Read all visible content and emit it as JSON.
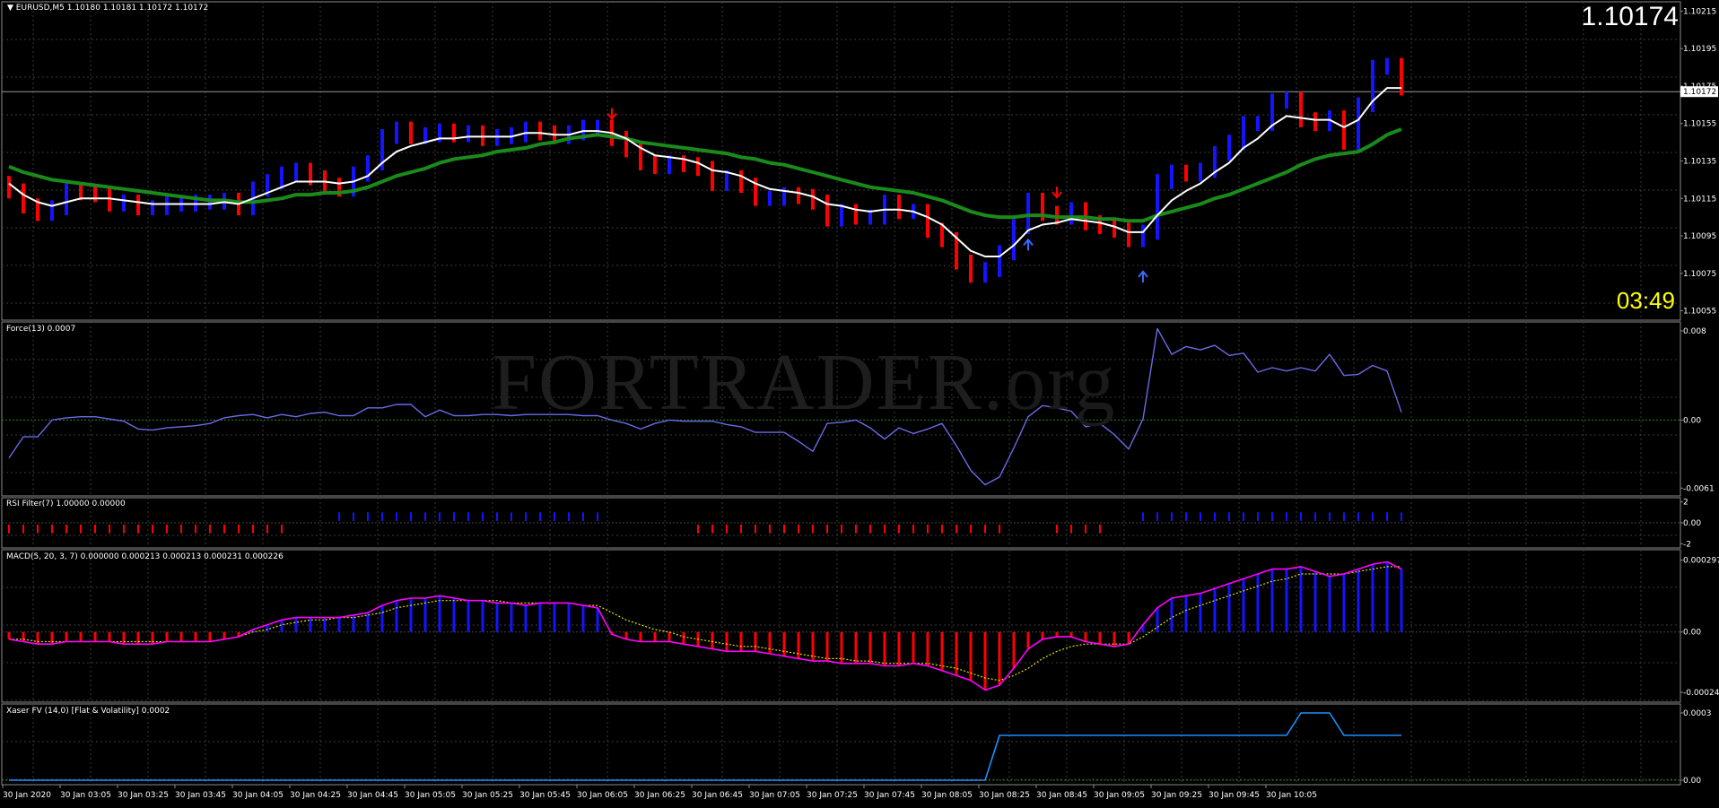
{
  "symbol_header": "EURUSD,M5  1.10180 1.10181 1.10172 1.10172",
  "big_price": "1.10174",
  "countdown": "03:49",
  "watermark": {
    "main": "FORTRADER",
    "suffix": ".org"
  },
  "colors": {
    "background": "#000000",
    "grid": "#3a3a3a",
    "bull_bar": "#1414ff",
    "bear_bar": "#ff0000",
    "fast_ma": "#ffffff",
    "slow_ma": "#1a8a1a",
    "force_line": "#6a6ae8",
    "macd_line": "#ff00ff",
    "signal_line": "#e0e000",
    "xaser_line": "#1e90ff"
  },
  "price_axis": {
    "ticks": [
      "1.10215",
      "1.10195",
      "1.10175",
      "1.10155",
      "1.10135",
      "1.10115",
      "1.10095",
      "1.10075",
      "1.10055"
    ],
    "current_label": "1.10172"
  },
  "force": {
    "title": "Force(13) 0.0007",
    "axis": [
      "0.008",
      "0.00",
      "-0.0061"
    ]
  },
  "rsi": {
    "title": "RSI Filter(7) 1.00000 0.00000",
    "axis": [
      "2",
      "0.00",
      "-2"
    ]
  },
  "macd": {
    "title": "MACD(5, 20, 3, 7) 0.000000 0.000213 0.000213 0.000231 0.000226",
    "axis": [
      "0.000297",
      "0.00",
      "-0.000249"
    ]
  },
  "xaser": {
    "title": "Xaser FV (14,0) [Flat & Volatility] 0.0002",
    "axis": [
      "0.0003",
      "0.00"
    ]
  },
  "time_axis": [
    "30 Jan 2020",
    "30 Jan 03:05",
    "30 Jan 03:25",
    "30 Jan 03:45",
    "30 Jan 04:05",
    "30 Jan 04:25",
    "30 Jan 04:45",
    "30 Jan 05:05",
    "30 Jan 05:25",
    "30 Jan 05:45",
    "30 Jan 06:05",
    "30 Jan 06:25",
    "30 Jan 06:45",
    "30 Jan 07:05",
    "30 Jan 07:25",
    "30 Jan 07:45",
    "30 Jan 08:05",
    "30 Jan 08:25",
    "30 Jan 08:45",
    "30 Jan 09:05",
    "30 Jan 09:25",
    "30 Jan 09:45",
    "30 Jan 10:05"
  ],
  "chart_data": {
    "type": "line",
    "title": "EURUSD,M5",
    "price_bars_close": [
      1.10119,
      1.10111,
      1.10107,
      1.1011,
      1.10119,
      1.10118,
      1.10117,
      1.10112,
      1.10113,
      1.1011,
      1.1011,
      1.10112,
      1.10112,
      1.10113,
      1.10113,
      1.10114,
      1.1011,
      1.1012,
      1.10124,
      1.10128,
      1.1013,
      1.10126,
      1.10122,
      1.1012,
      1.10128,
      1.10134,
      1.10148,
      1.10152,
      1.10148,
      1.10149,
      1.10151,
      1.10149,
      1.1015,
      1.10147,
      1.10148,
      1.10149,
      1.10152,
      1.1015,
      1.10148,
      1.1015,
      1.10153,
      1.10153,
      1.10147,
      1.10141,
      1.10134,
      1.10132,
      1.10134,
      1.10133,
      1.10131,
      1.10123,
      1.10126,
      1.10122,
      1.10115,
      1.10115,
      1.10117,
      1.10116,
      1.10113,
      1.10104,
      1.10108,
      1.10105,
      1.10105,
      1.10113,
      1.10108,
      1.10108,
      1.10098,
      1.10093,
      1.10081,
      1.10074,
      1.10077,
      1.10086,
      1.101,
      1.10114,
      1.10107,
      1.10105,
      1.10109,
      1.10102,
      1.101,
      1.10098,
      1.10093,
      1.10097,
      1.10124,
      1.10129,
      1.10128,
      1.1013,
      1.10139,
      1.10145,
      1.10155,
      1.10155,
      1.10167,
      1.10168,
      1.10157,
      1.10155,
      1.10158,
      1.10145,
      1.10165,
      1.10185,
      1.10186,
      1.10174
    ],
    "fast_ma": [
      1.10123,
      1.10117,
      1.10113,
      1.10111,
      1.10113,
      1.10115,
      1.10115,
      1.10115,
      1.10114,
      1.10113,
      1.10112,
      1.10112,
      1.10112,
      1.10112,
      1.10112,
      1.10113,
      1.10112,
      1.10115,
      1.10118,
      1.10121,
      1.10124,
      1.10124,
      1.10124,
      1.10123,
      1.10124,
      1.10127,
      1.10134,
      1.1014,
      1.10143,
      1.10145,
      1.10147,
      1.10147,
      1.10148,
      1.10148,
      1.10148,
      1.10148,
      1.1015,
      1.1015,
      1.10149,
      1.10149,
      1.10151,
      1.10151,
      1.1015,
      1.10147,
      1.10142,
      1.10138,
      1.10137,
      1.10136,
      1.10134,
      1.1013,
      1.10129,
      1.10127,
      1.10123,
      1.1012,
      1.10119,
      1.10118,
      1.10116,
      1.10112,
      1.10111,
      1.10109,
      1.10108,
      1.10109,
      1.10109,
      1.10108,
      1.10105,
      1.10101,
      1.10094,
      1.10087,
      1.10084,
      1.10084,
      1.1009,
      1.10098,
      1.10101,
      1.10102,
      1.10104,
      1.10103,
      1.10102,
      1.101,
      1.10097,
      1.10097,
      1.10106,
      1.10114,
      1.10119,
      1.10123,
      1.10129,
      1.10134,
      1.10142,
      1.10147,
      1.10154,
      1.10159,
      1.10158,
      1.10157,
      1.10157,
      1.10153,
      1.10157,
      1.10167,
      1.10174,
      1.10174
    ],
    "slow_ma": [
      1.10132,
      1.10129,
      1.10127,
      1.10125,
      1.10124,
      1.10123,
      1.10122,
      1.10121,
      1.1012,
      1.10119,
      1.10118,
      1.10117,
      1.10116,
      1.10115,
      1.10114,
      1.10114,
      1.10113,
      1.10113,
      1.10114,
      1.10115,
      1.10117,
      1.10117,
      1.10118,
      1.10118,
      1.10119,
      1.10121,
      1.10124,
      1.10127,
      1.10129,
      1.10131,
      1.10134,
      1.10136,
      1.10137,
      1.10138,
      1.1014,
      1.10141,
      1.10142,
      1.10144,
      1.10145,
      1.10147,
      1.10148,
      1.10149,
      1.10148,
      1.10147,
      1.10145,
      1.10144,
      1.10143,
      1.10142,
      1.10141,
      1.1014,
      1.10139,
      1.10137,
      1.10136,
      1.10134,
      1.10133,
      1.10131,
      1.10129,
      1.10127,
      1.10125,
      1.10123,
      1.10121,
      1.1012,
      1.10119,
      1.10118,
      1.10116,
      1.10114,
      1.10111,
      1.10108,
      1.10106,
      1.10105,
      1.10105,
      1.10106,
      1.10106,
      1.10105,
      1.10105,
      1.10105,
      1.10104,
      1.10104,
      1.10103,
      1.10103,
      1.10106,
      1.10108,
      1.1011,
      1.10112,
      1.10115,
      1.10117,
      1.1012,
      1.10123,
      1.10126,
      1.10129,
      1.10133,
      1.10136,
      1.10138,
      1.10139,
      1.1014,
      1.10144,
      1.10149,
      1.10152
    ],
    "force": [
      -0.0034,
      -0.0015,
      -0.0015,
      0.0,
      0.0002,
      0.0003,
      0.0003,
      0.0001,
      -0.0001,
      -0.0008,
      -0.0009,
      -0.0007,
      -0.0006,
      -0.0005,
      -0.0003,
      0.0002,
      0.0004,
      0.0005,
      0.0002,
      0.0005,
      0.0003,
      0.0006,
      0.0007,
      0.0004,
      0.0004,
      0.0011,
      0.0011,
      0.0014,
      0.0014,
      0.0003,
      0.0009,
      0.0004,
      0.0004,
      0.0005,
      0.0005,
      0.0004,
      0.0005,
      0.0005,
      0.0005,
      0.0005,
      0.0004,
      0.0004,
      0.0,
      -0.0003,
      -0.0008,
      -0.0003,
      0.0,
      -0.0001,
      -0.0001,
      -0.0001,
      -0.0004,
      -0.0006,
      -0.0011,
      -0.0011,
      -0.0011,
      -0.0019,
      -0.0028,
      -0.0003,
      -0.0002,
      0.0,
      -0.0007,
      -0.0017,
      -0.0007,
      -0.0012,
      -0.0008,
      -0.0003,
      -0.0023,
      -0.0045,
      -0.0058,
      -0.0051,
      -0.0025,
      0.0003,
      0.0013,
      0.0011,
      0.0008,
      -0.0006,
      -0.0003,
      -0.0013,
      -0.0026,
      0.0001,
      0.0082,
      0.0059,
      0.0066,
      0.0063,
      0.0067,
      0.0058,
      0.006,
      0.0043,
      0.0047,
      0.0044,
      0.0047,
      0.0044,
      0.0059,
      0.004,
      0.0041,
      0.0049,
      0.0044,
      0.0007
    ],
    "rsi_filter": [
      -1,
      -1,
      -1,
      -1,
      -1,
      -1,
      -1,
      -1,
      -1,
      -1,
      -1,
      -1,
      -1,
      -1,
      -1,
      -1,
      -1,
      -1,
      -1,
      -1,
      0,
      0,
      0,
      1,
      1,
      1,
      1,
      1,
      1,
      1,
      1,
      1,
      1,
      1,
      1,
      1,
      1,
      1,
      1,
      1,
      1,
      1,
      0,
      0,
      0,
      0,
      0,
      0,
      -1,
      -1,
      -1,
      -1,
      -1,
      -1,
      -1,
      -1,
      -1,
      -1,
      -1,
      -1,
      -1,
      -1,
      -1,
      -1,
      -1,
      -1,
      -1,
      -1,
      -1,
      -1,
      0,
      0,
      0,
      -1,
      -1,
      -1,
      -1,
      0,
      0,
      1,
      1,
      1,
      1,
      1,
      1,
      1,
      1,
      1,
      1,
      1,
      1,
      1,
      1,
      1,
      1,
      1,
      1,
      1
    ],
    "macd_hist": [
      -3e-05,
      -4e-05,
      -5e-05,
      -5e-05,
      -4e-05,
      -4e-05,
      -4e-05,
      -4e-05,
      -5e-05,
      -5e-05,
      -5e-05,
      -4e-05,
      -4e-05,
      -4e-05,
      -4e-05,
      -3e-05,
      -2e-05,
      1e-05,
      3e-05,
      5e-05,
      6e-05,
      6e-05,
      6e-05,
      6e-05,
      7e-05,
      8e-05,
      0.00011,
      0.00013,
      0.00014,
      0.00014,
      0.00015,
      0.00014,
      0.00013,
      0.00013,
      0.00012,
      0.00012,
      0.00011,
      0.00012,
      0.00012,
      0.00012,
      0.00011,
      0.0001,
      -1e-05,
      -3e-05,
      -4e-05,
      -4e-05,
      -4e-05,
      -5e-05,
      -6e-05,
      -7e-05,
      -8e-05,
      -8e-05,
      -8e-05,
      -9e-05,
      -0.0001,
      -0.00011,
      -0.00012,
      -0.00012,
      -0.00013,
      -0.00013,
      -0.00013,
      -0.00014,
      -0.00014,
      -0.00013,
      -0.00014,
      -0.00016,
      -0.00018,
      -0.0002,
      -0.00024,
      -0.00022,
      -0.00015,
      -7e-05,
      -3e-05,
      -2e-05,
      -2e-05,
      -4e-05,
      -5e-05,
      -6e-05,
      -5e-05,
      3e-05,
      0.0001,
      0.00014,
      0.00015,
      0.00016,
      0.00018,
      0.0002,
      0.00022,
      0.00024,
      0.00026,
      0.00026,
      0.00027,
      0.00025,
      0.00023,
      0.00024,
      0.00026,
      0.00028,
      0.00029,
      0.00026
    ],
    "macd_signal": [
      -3e-05,
      -3e-05,
      -4e-05,
      -4e-05,
      -4e-05,
      -4e-05,
      -4e-05,
      -4e-05,
      -4e-05,
      -4e-05,
      -4e-05,
      -4e-05,
      -4e-05,
      -4e-05,
      -4e-05,
      -3e-05,
      -2e-05,
      0.0,
      1e-05,
      3e-05,
      4e-05,
      5e-05,
      5e-05,
      6e-05,
      6e-05,
      7e-05,
      8e-05,
      0.0001,
      0.00011,
      0.00012,
      0.00013,
      0.00013,
      0.00013,
      0.00013,
      0.00013,
      0.00012,
      0.00012,
      0.00012,
      0.00012,
      0.00012,
      0.00011,
      0.00011,
      8e-05,
      5e-05,
      3e-05,
      1e-05,
      0.0,
      -2e-05,
      -3e-05,
      -4e-05,
      -5e-05,
      -6e-05,
      -6e-05,
      -7e-05,
      -8e-05,
      -9e-05,
      -0.0001,
      -0.00011,
      -0.00011,
      -0.00012,
      -0.00012,
      -0.00013,
      -0.00013,
      -0.00013,
      -0.00013,
      -0.00014,
      -0.00015,
      -0.00017,
      -0.00019,
      -0.0002,
      -0.00018,
      -0.00015,
      -0.00011,
      -8e-05,
      -6e-05,
      -5e-05,
      -5e-05,
      -5e-05,
      -5e-05,
      -2e-05,
      2e-05,
      6e-05,
      9e-05,
      0.00011,
      0.00013,
      0.00015,
      0.00017,
      0.00019,
      0.00021,
      0.00022,
      0.00024,
      0.00024,
      0.00024,
      0.00024,
      0.00025,
      0.00026,
      0.00027,
      0.00027
    ],
    "xaser": [
      0,
      0,
      0,
      0,
      0,
      0,
      0,
      0,
      0,
      0,
      0,
      0,
      0,
      0,
      0,
      0,
      0,
      0,
      0,
      0,
      0,
      0,
      0,
      0,
      0,
      0,
      0,
      0,
      0,
      0,
      0,
      0,
      0,
      0,
      0,
      0,
      0,
      0,
      0,
      0,
      0,
      0,
      0,
      0,
      0,
      0,
      0,
      0,
      0,
      0,
      0,
      0,
      0,
      0,
      0,
      0,
      0,
      0,
      0,
      0,
      0,
      0,
      0,
      0,
      0,
      0,
      0,
      0,
      0,
      0.0002,
      0.0002,
      0.0002,
      0.0002,
      0.0002,
      0.0002,
      0.0002,
      0.0002,
      0.0002,
      0.0002,
      0.0002,
      0.0002,
      0.0002,
      0.0002,
      0.0002,
      0.0002,
      0.0002,
      0.0002,
      0.0002,
      0.0002,
      0.0002,
      0.0003,
      0.0003,
      0.0003,
      0.0002,
      0.0002,
      0.0002,
      0.0002,
      0.0002
    ],
    "arrows": [
      {
        "bar": 42,
        "dir": "down"
      },
      {
        "bar": 71,
        "dir": "up"
      },
      {
        "bar": 73,
        "dir": "down"
      },
      {
        "bar": 79,
        "dir": "up"
      }
    ]
  }
}
